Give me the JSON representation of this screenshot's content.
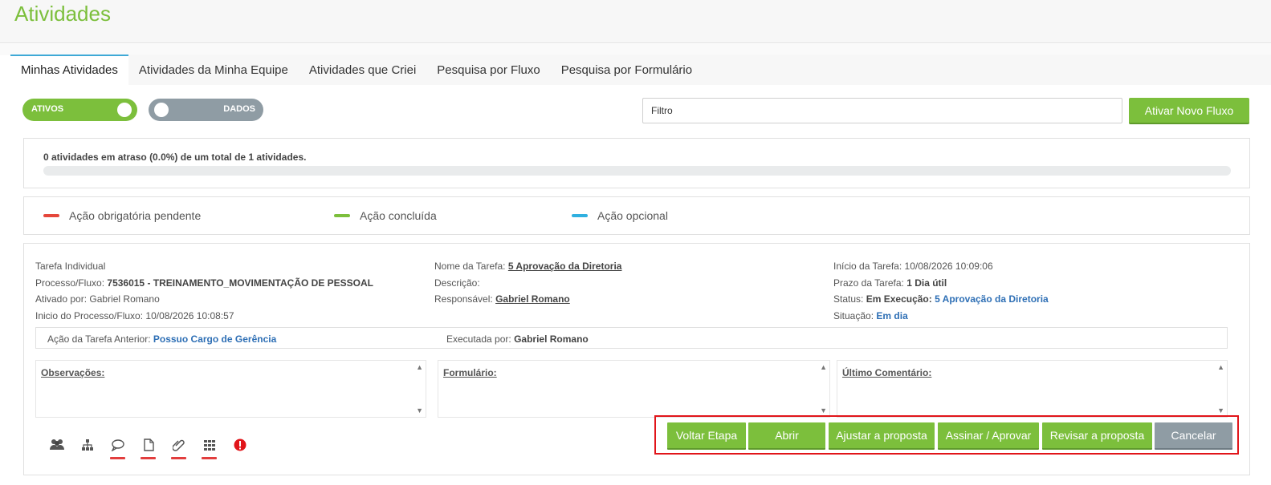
{
  "page": {
    "title": "Atividades"
  },
  "tabs": [
    {
      "label": "Minhas Atividades",
      "active": true
    },
    {
      "label": "Atividades da Minha Equipe"
    },
    {
      "label": "Atividades que Criei"
    },
    {
      "label": "Pesquisa por Fluxo"
    },
    {
      "label": "Pesquisa por Formulário"
    }
  ],
  "toolbar": {
    "toggle_ativos": "ATIVOS",
    "toggle_dados": "DADOS",
    "filter_placeholder": "Filtro",
    "new_flow_button": "Ativar Novo Fluxo"
  },
  "stats": {
    "text": "0 atividades em atraso (0.0%) de um total de 1 atividades.",
    "overdue_fraction": 0.0
  },
  "legend": [
    {
      "label": "Ação obrigatória pendente",
      "color": "#e5473b"
    },
    {
      "label": "Ação concluída",
      "color": "#7cbf3c"
    },
    {
      "label": "Ação opcional",
      "color": "#2fb0e0"
    }
  ],
  "task": {
    "type": "Tarefa Individual",
    "process_label": "Processo/Fluxo:",
    "process_value": "7536015 - TREINAMENTO_MOVIMENTAÇÃO DE PESSOAL",
    "activated_label": "Ativado por:",
    "activated_value": "Gabriel Romano",
    "process_start_label": "Inicio do Processo/Fluxo:",
    "process_start_value": "10/08/2026 10:08:57",
    "task_name_label": "Nome da Tarefa:",
    "task_name_value": "5 Aprovação da Diretoria",
    "description_label": "Descrição:",
    "responsible_label": "Responsável:",
    "responsible_value": "Gabriel Romano",
    "task_start_label": "Início da Tarefa:",
    "task_start_value": "10/08/2026 10:09:06",
    "deadline_label": "Prazo da Tarefa:",
    "deadline_value": "1 Dia útil",
    "status_label": "Status:",
    "status_value": "Em Execução:",
    "status_step": "5 Aprovação da Diretoria",
    "situation_label": "Situação:",
    "situation_value": "Em dia",
    "prev_action_label": "Ação da Tarefa Anterior:",
    "prev_action_value": "Possuo Cargo de Gerência",
    "executed_by_label": "Executada por:",
    "executed_by_value": "Gabriel Romano",
    "observations_label": "Observações:",
    "form_label": "Formulário:",
    "last_comment_label": "Último Comentário:"
  },
  "icons": [
    {
      "name": "users-icon",
      "underline": false
    },
    {
      "name": "hierarchy-icon",
      "underline": false
    },
    {
      "name": "comment-icon",
      "underline": true
    },
    {
      "name": "document-icon",
      "underline": true
    },
    {
      "name": "paperclip-icon",
      "underline": true
    },
    {
      "name": "grid-icon",
      "underline": true
    },
    {
      "name": "alert-icon",
      "underline": false,
      "color": "#e1151a"
    }
  ],
  "actions": [
    {
      "label": "Voltar Etapa"
    },
    {
      "label": "Abrir"
    },
    {
      "label": "Ajustar a proposta"
    },
    {
      "label": "Assinar / Aprovar"
    },
    {
      "label": "Revisar a proposta"
    },
    {
      "label": "Cancelar",
      "style": "gray"
    }
  ]
}
